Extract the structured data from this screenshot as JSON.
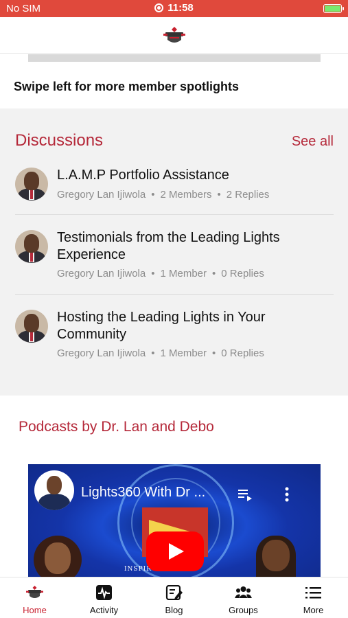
{
  "status_bar": {
    "carrier": "No SIM",
    "time": "11:58",
    "battery_color": "#7be86f",
    "bar_color": "#e0493c"
  },
  "header": {
    "logo_icon": "shield-logo-icon"
  },
  "spotlight": {
    "swipe_hint": "Swipe left for more member spotlights"
  },
  "discussions": {
    "title": "Discussions",
    "see_all": "See all",
    "accent_color": "#b5293a",
    "items": [
      {
        "title": "L.A.M.P Portfolio Assistance",
        "author": "Gregory Lan Ijiwola",
        "members": "2 Members",
        "replies": "2 Replies"
      },
      {
        "title": "Testimonials from the Leading Lights Experience",
        "author": "Gregory Lan Ijiwola",
        "members": "1 Member",
        "replies": "0 Replies"
      },
      {
        "title": "Hosting the Leading Lights in Your Community",
        "author": "Gregory Lan Ijiwola",
        "members": "1 Member",
        "replies": "0 Replies"
      }
    ],
    "separator": "•"
  },
  "podcasts": {
    "title": "Podcasts by Dr. Lan and Debo",
    "video": {
      "title": "Lights360 With Dr ...",
      "caption": "INSPIR    F THE",
      "play_icon": "play-icon"
    }
  },
  "tabs": [
    {
      "label": "Home",
      "icon": "home-logo-icon",
      "active": true
    },
    {
      "label": "Activity",
      "icon": "activity-icon",
      "active": false
    },
    {
      "label": "Blog",
      "icon": "blog-icon",
      "active": false
    },
    {
      "label": "Groups",
      "icon": "groups-icon",
      "active": false
    },
    {
      "label": "More",
      "icon": "menu-icon",
      "active": false
    }
  ]
}
